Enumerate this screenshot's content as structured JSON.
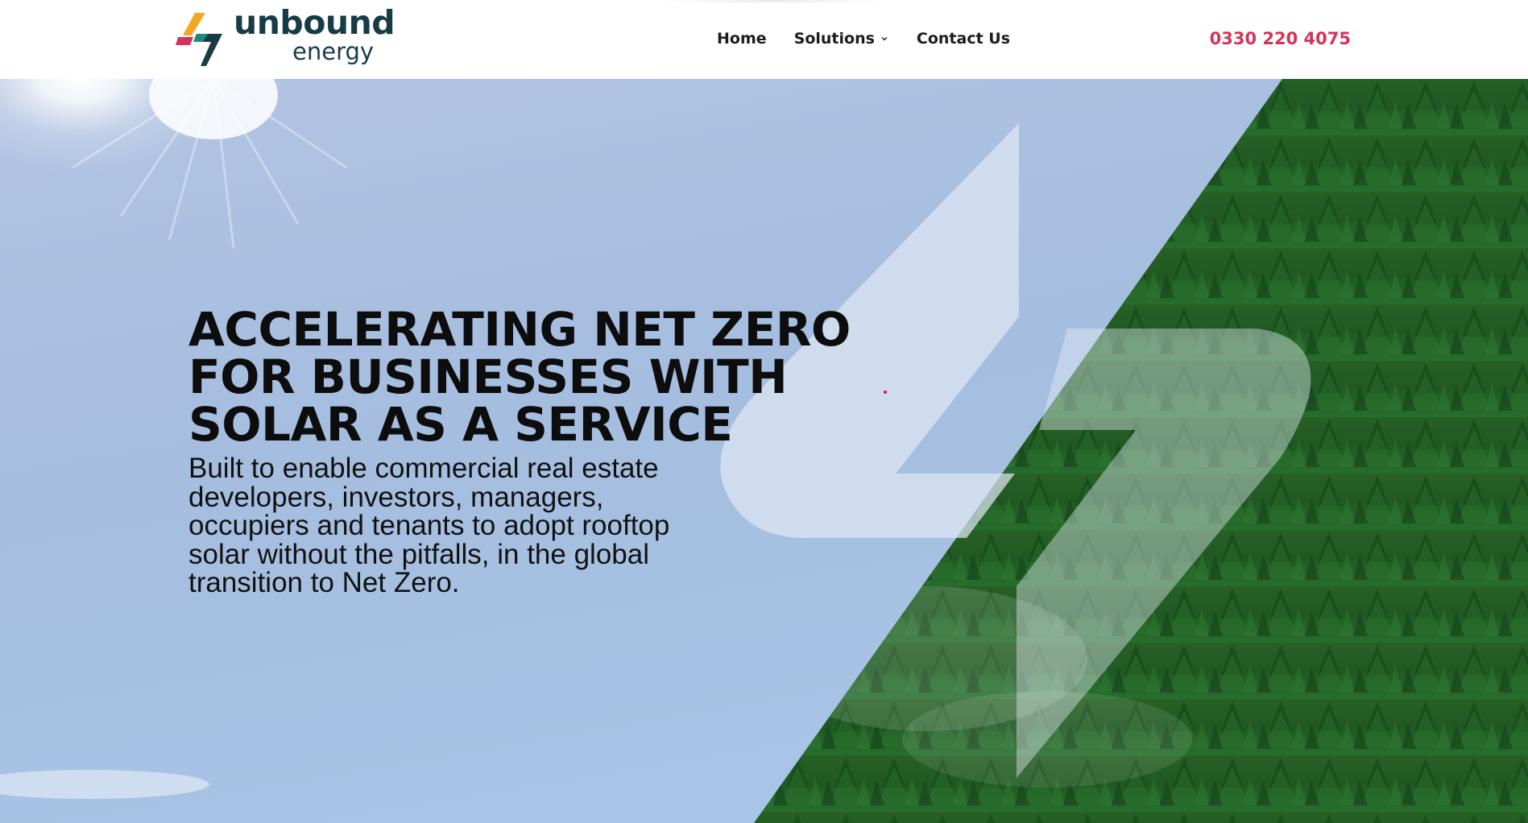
{
  "header": {
    "logo": {
      "word_1": "unbound",
      "word_2": "energy",
      "colors": {
        "teal": "#173c46",
        "orange": "#f5a623",
        "red": "#d3345b",
        "green": "#1f8a78"
      }
    },
    "nav": {
      "home": "Home",
      "solutions": "Solutions",
      "contact": "Contact Us"
    },
    "phone": "0330 220 4075"
  },
  "hero": {
    "title_lines": [
      "ACCELERATING NET ZERO",
      "FOR BUSINESSES WITH",
      "SOLAR AS A SERVICE"
    ],
    "subtitle_lines": [
      "Built to enable commercial real estate",
      "developers, investors, managers,",
      "occupiers and tenants to adopt rooftop",
      "solar without the pitfalls, in the global",
      "transition to Net Zero."
    ],
    "background": {
      "sky_color": "#9fb9da",
      "forest_color": "#1f5a24",
      "bolt_overlay_color": "#dfe8f4"
    }
  },
  "colors": {
    "accent_phone": "#d3345b",
    "text_dark": "#0d0d0d"
  }
}
